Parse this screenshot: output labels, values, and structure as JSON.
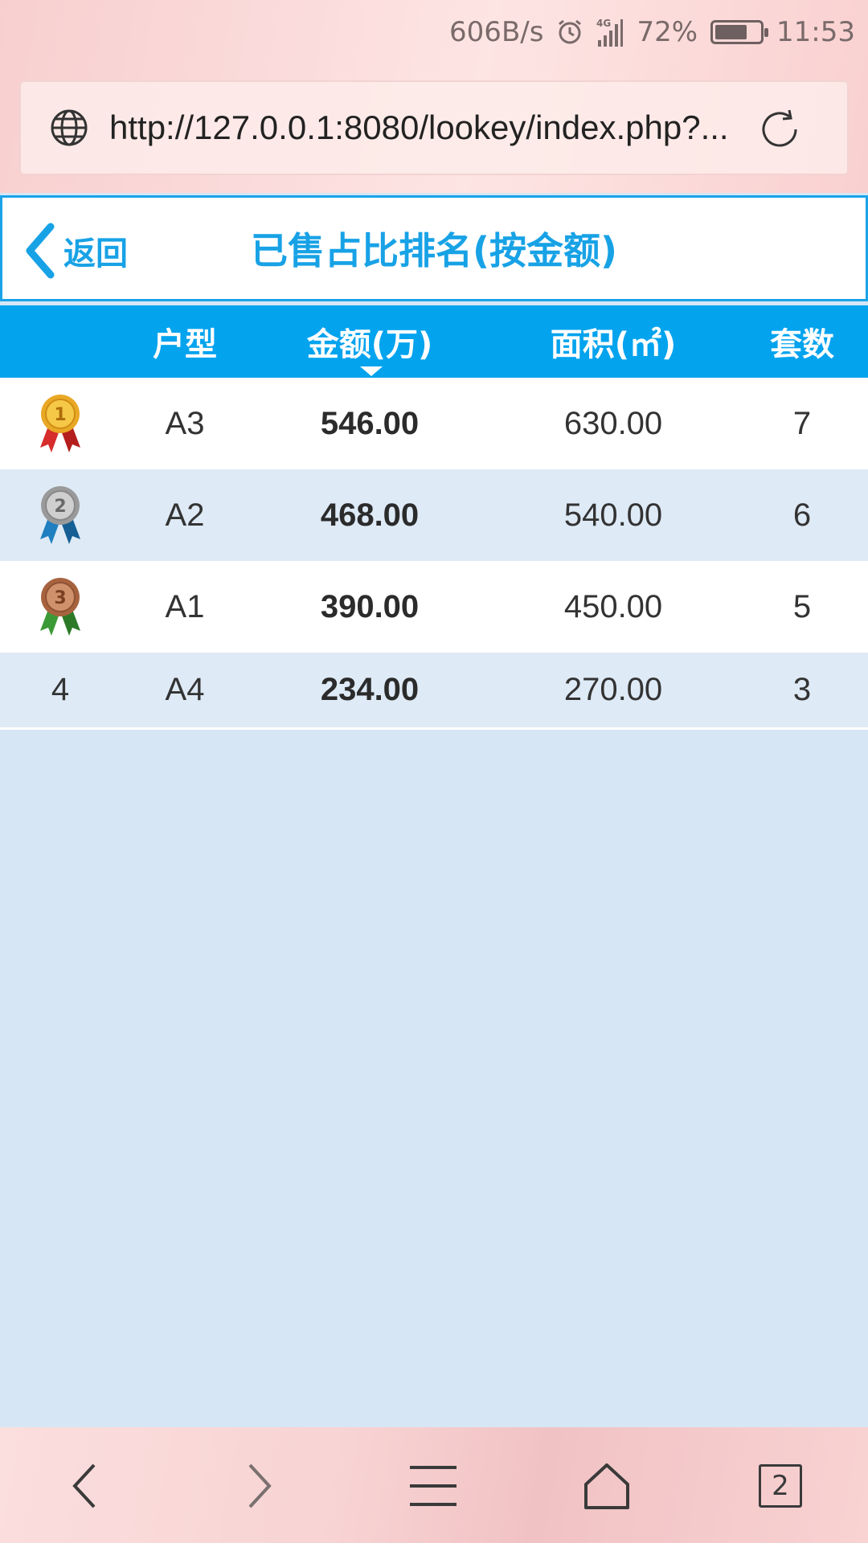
{
  "status_bar": {
    "net_speed": "606B/s",
    "signal_label": "4G",
    "battery_percent": "72%",
    "battery_level": 0.72,
    "time": "11:53"
  },
  "browser": {
    "url": "http://127.0.0.1:8080/lookey/index.php?..."
  },
  "header": {
    "back_label": "返回",
    "title": "已售占比排名(按金额)"
  },
  "table": {
    "columns": [
      "",
      "户型",
      "金额(万)",
      "面积(㎡)",
      "套数"
    ],
    "sorted_column": "金额(万)",
    "rows": [
      {
        "rank": "1",
        "medal": "gold",
        "type": "A3",
        "amount": "546.00",
        "area": "630.00",
        "count": "7"
      },
      {
        "rank": "2",
        "medal": "silver",
        "type": "A2",
        "amount": "468.00",
        "area": "540.00",
        "count": "6"
      },
      {
        "rank": "3",
        "medal": "bronze",
        "type": "A1",
        "amount": "390.00",
        "area": "450.00",
        "count": "5"
      },
      {
        "rank": "4",
        "medal": "",
        "type": "A4",
        "amount": "234.00",
        "area": "270.00",
        "count": "3"
      }
    ]
  },
  "bottom_nav": {
    "tab_count": "2",
    "icons": [
      "back-arrow-icon",
      "forward-arrow-icon",
      "menu-icon",
      "home-icon",
      "tabs-icon"
    ]
  },
  "colors": {
    "accent": "#03a3ee",
    "gold": "#e9a825",
    "silver": "#a9a9a9",
    "bronze": "#b5724b"
  }
}
